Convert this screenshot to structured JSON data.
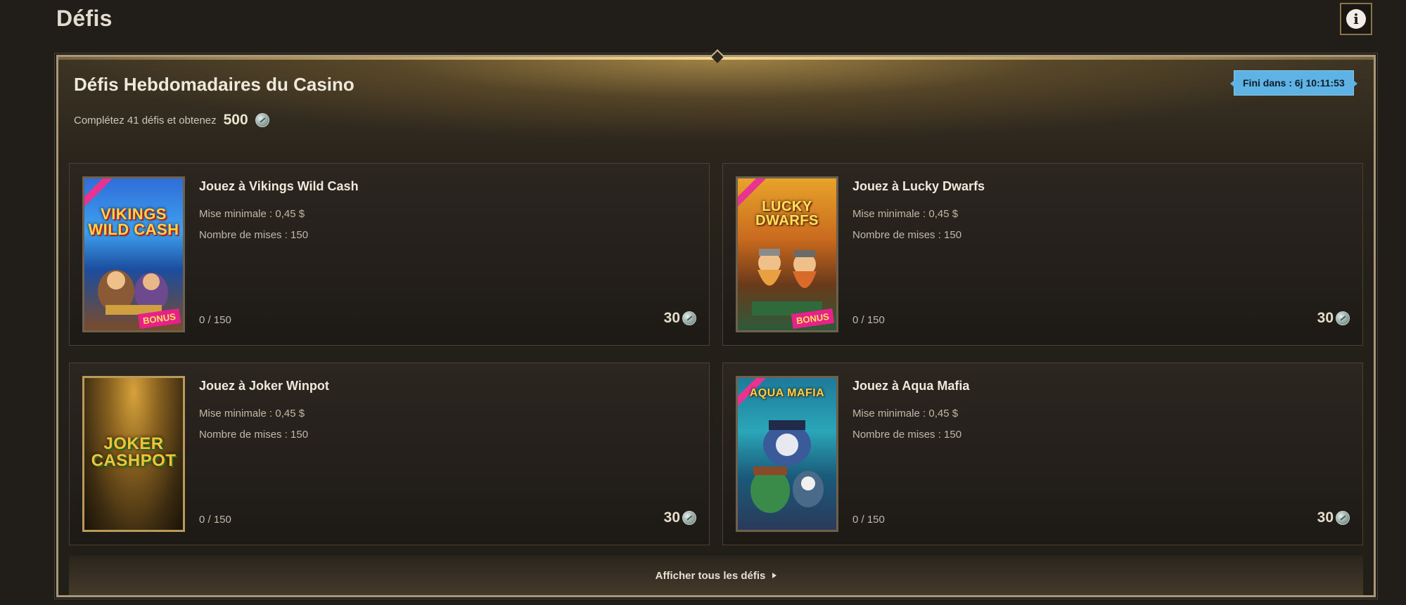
{
  "page": {
    "title": "Défis"
  },
  "header": {
    "info_icon": "info-icon"
  },
  "section": {
    "title": "Défis Hebdomadaires du Casino",
    "subtitle_text": "Complétez 41 défis et obtenez",
    "subtitle_reward": "500",
    "timer": "Fini dans : 6j 10:11:53"
  },
  "cards": [
    {
      "title": "Jouez à Vikings Wild Cash",
      "min_bet": "Mise minimale : 0,45 $",
      "num_bets": "Nombre de mises : 150",
      "progress": "0 / 150",
      "progress_fraction": 0,
      "reward": "30",
      "game_logo": "VIKINGS WILD CASH",
      "bonus_tag": "BONUS"
    },
    {
      "title": "Jouez à Lucky Dwarfs",
      "min_bet": "Mise minimale : 0,45 $",
      "num_bets": "Nombre de mises : 150",
      "progress": "0 / 150",
      "progress_fraction": 0,
      "reward": "30",
      "game_logo": "LUCKY DWARFS",
      "bonus_tag": "BONUS"
    },
    {
      "title": "Jouez à Joker Winpot",
      "min_bet": "Mise minimale : 0,45 $",
      "num_bets": "Nombre de mises : 150",
      "progress": "0 / 150",
      "progress_fraction": 0,
      "reward": "30",
      "game_logo": "JOKER CASHPOT"
    },
    {
      "title": "Jouez à Aqua Mafia",
      "min_bet": "Mise minimale : 0,45 $",
      "num_bets": "Nombre de mises : 150",
      "progress": "0 / 150",
      "progress_fraction": 0,
      "reward": "30",
      "game_logo": "AQUA MAFIA"
    }
  ],
  "footer": {
    "show_all_label": "Afficher tous les défis"
  },
  "colors": {
    "background": "#211d18",
    "gold_border": "#a89779",
    "timer_bg": "#5fb2e4",
    "text_primary": "#efe8dc",
    "text_secondary": "#c1b8aa"
  },
  "icons": {
    "coin": "coin-icon",
    "arrow": "arrow-right-icon",
    "info": "info-icon"
  }
}
